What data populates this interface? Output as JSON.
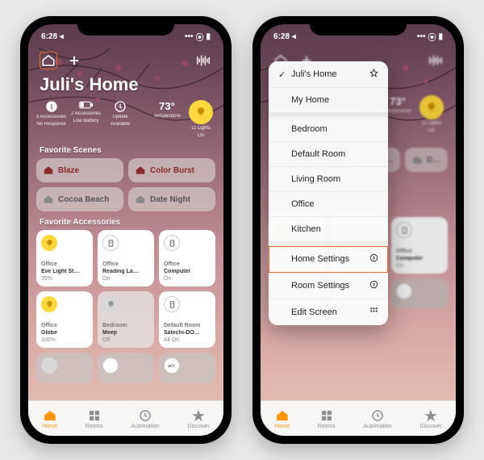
{
  "statusbar": {
    "time": "6:28 ◂",
    "signal": "•••",
    "wifi": "⦿",
    "battery": "▮"
  },
  "header": {
    "home_title": "Juli's Home"
  },
  "status_cards": [
    {
      "icon": "info",
      "big": "",
      "sub1": "3 Accessories",
      "sub2": "No Response"
    },
    {
      "icon": "battery",
      "big": "",
      "sub1": "2 Accessories",
      "sub2": "Low Battery"
    },
    {
      "icon": "update",
      "big": "",
      "sub1": "Update",
      "sub2": "Available"
    },
    {
      "icon": "temp",
      "big": "73°",
      "sub1": "Temperature",
      "sub2": ""
    },
    {
      "icon": "light",
      "big": "",
      "sub1": "11 Lights",
      "sub2": "On"
    }
  ],
  "sections": {
    "scenes": "Favorite Scenes",
    "accessories": "Favorite Accessories"
  },
  "scenes": [
    {
      "name": "Blaze",
      "color": "#8b2a2a",
      "icon": "house"
    },
    {
      "name": "Color Burst",
      "color": "#8b2a2a",
      "icon": "house"
    },
    {
      "name": "Cocoa Beach",
      "color": "#555",
      "icon": "house"
    },
    {
      "name": "Date Night",
      "color": "#555",
      "icon": "house"
    }
  ],
  "accessories": [
    {
      "room": "Office",
      "name": "Eve Light St…",
      "state": "35%",
      "icon": "bulb",
      "on": true
    },
    {
      "room": "Office",
      "name": "Reading La…",
      "state": "On",
      "icon": "switch",
      "on": true
    },
    {
      "room": "Office",
      "name": "Computer",
      "state": "On",
      "icon": "switch",
      "on": true
    },
    {
      "room": "Office",
      "name": "Globe",
      "state": "100%",
      "icon": "bulb",
      "on": true
    },
    {
      "room": "Bedroom",
      "name": "Meep",
      "state": "Off",
      "icon": "bulb",
      "on": false
    },
    {
      "room": "Default Room",
      "name": "Satechi-DO…",
      "state": "All On",
      "icon": "switch",
      "on": true
    }
  ],
  "accessories_row3": [
    {
      "icon": "bulb"
    },
    {
      "icon": "switch"
    },
    {
      "icon": "tv"
    }
  ],
  "tabs": [
    {
      "label": "Home",
      "active": true,
      "icon": "home"
    },
    {
      "label": "Rooms",
      "active": false,
      "icon": "rooms"
    },
    {
      "label": "Automation",
      "active": false,
      "icon": "automation"
    },
    {
      "label": "Discover",
      "active": false,
      "icon": "discover"
    }
  ],
  "menu": {
    "homes": [
      {
        "label": "Juli's Home",
        "checked": true,
        "pin": true
      },
      {
        "label": "My Home",
        "checked": false
      }
    ],
    "rooms": [
      {
        "label": "Bedroom"
      },
      {
        "label": "Default Room"
      },
      {
        "label": "Living Room"
      },
      {
        "label": "Office"
      },
      {
        "label": "Kitchen"
      }
    ],
    "actions": [
      {
        "label": "Home Settings",
        "chevron": true,
        "hl": true
      },
      {
        "label": "Room Settings",
        "chevron": true
      },
      {
        "label": "Edit Screen",
        "grid": true
      }
    ]
  }
}
